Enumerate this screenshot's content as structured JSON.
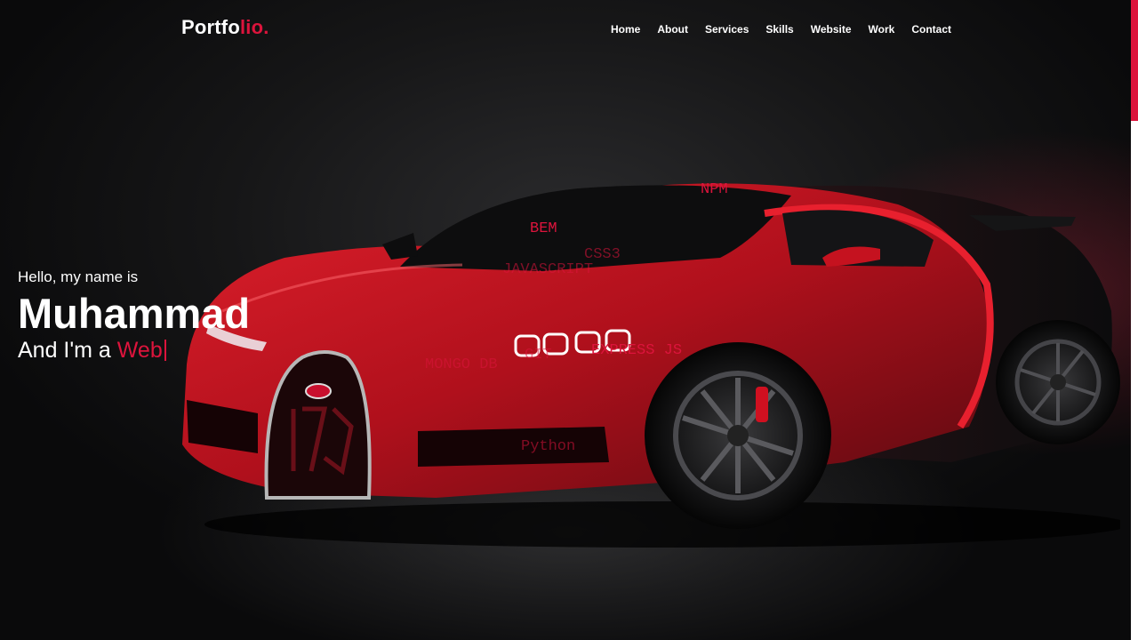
{
  "navbar": {
    "logo_main": "Portfo",
    "logo_accent": "lio.",
    "menu": [
      "Home",
      "About",
      "Services",
      "Skills",
      "Website",
      "Work",
      "Contact"
    ]
  },
  "hero": {
    "greeting": "Hello, my name is",
    "name": "Muhammad",
    "role_prefix": "And I'm a",
    "role_typed": "Web"
  },
  "skills": [
    "NPM",
    "BEM",
    "CSS3",
    "JAVASCRIPT",
    "GIT",
    "EXPRESS JS",
    "MONGO DB",
    "Python"
  ],
  "colors": {
    "accent": "#dc143c",
    "background": "#0b0b0c",
    "text": "#ffffff"
  }
}
